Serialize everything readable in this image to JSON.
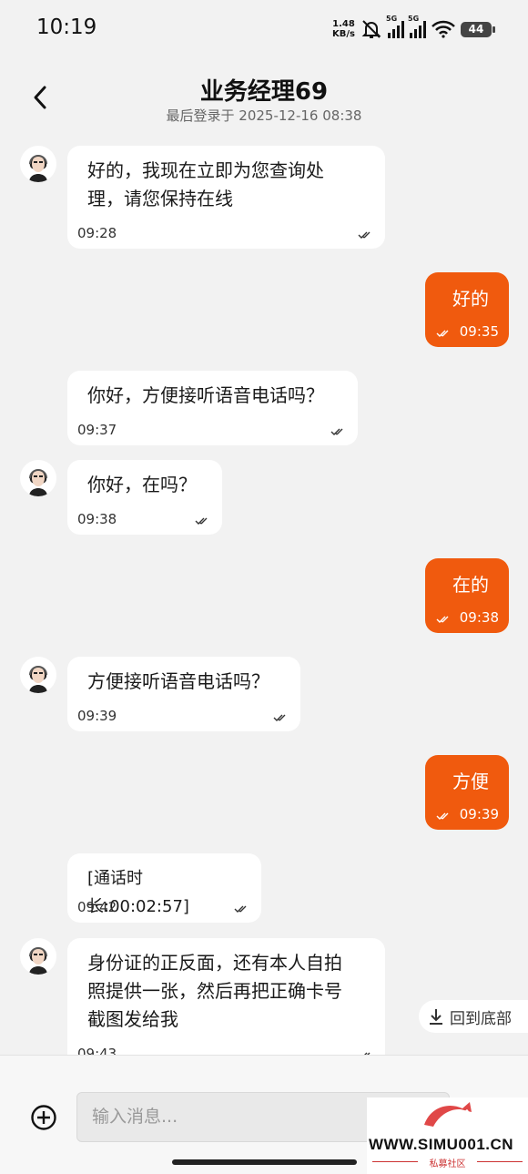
{
  "status_bar": {
    "time": "10:19",
    "net_speed_value": "1.48",
    "net_speed_unit": "KB/s",
    "signal1_tag": "5G",
    "signal2_tag": "5G",
    "battery": "44"
  },
  "header": {
    "title": "业务经理69",
    "subtitle": "最后登录于 2025-12-16 08:38",
    "back_icon": "chevron-left-icon"
  },
  "messages": [
    {
      "direction": "in",
      "avatar": true,
      "lines": [
        "好的，我现在立即为您查询处",
        "理，请您保持在线"
      ],
      "time": "09:28"
    },
    {
      "direction": "out",
      "lines": [
        "好的"
      ],
      "time": "09:35"
    },
    {
      "direction": "in",
      "avatar": false,
      "lines": [
        "你好，方便接听语音电话吗？"
      ],
      "time": "09:37"
    },
    {
      "direction": "in",
      "avatar": true,
      "lines": [
        "你好，在吗？"
      ],
      "time": "09:38"
    },
    {
      "direction": "out",
      "lines": [
        "在的"
      ],
      "time": "09:38"
    },
    {
      "direction": "in",
      "avatar": true,
      "lines": [
        "方便接听语音电话吗？"
      ],
      "time": "09:39"
    },
    {
      "direction": "out",
      "lines": [
        "方便"
      ],
      "time": "09:39"
    },
    {
      "direction": "in",
      "avatar": false,
      "lines": [
        "[通话时长:00:02:57]"
      ],
      "time": "09:42"
    },
    {
      "direction": "in",
      "avatar": true,
      "lines": [
        "身份证的正反面，还有本人自拍",
        "照提供一张，然后再把正确卡号",
        "截图发给我"
      ],
      "time": "09:43"
    }
  ],
  "scroll_to_bottom": {
    "label": "回到底部"
  },
  "composer": {
    "placeholder": "输入消息..."
  },
  "watermark": {
    "url": "WWW.SIMU001.CN",
    "sub": "私募社区"
  },
  "colors": {
    "accent": "#f05a0e",
    "background": "#f2f2f2",
    "bubble_in": "#ffffff"
  }
}
